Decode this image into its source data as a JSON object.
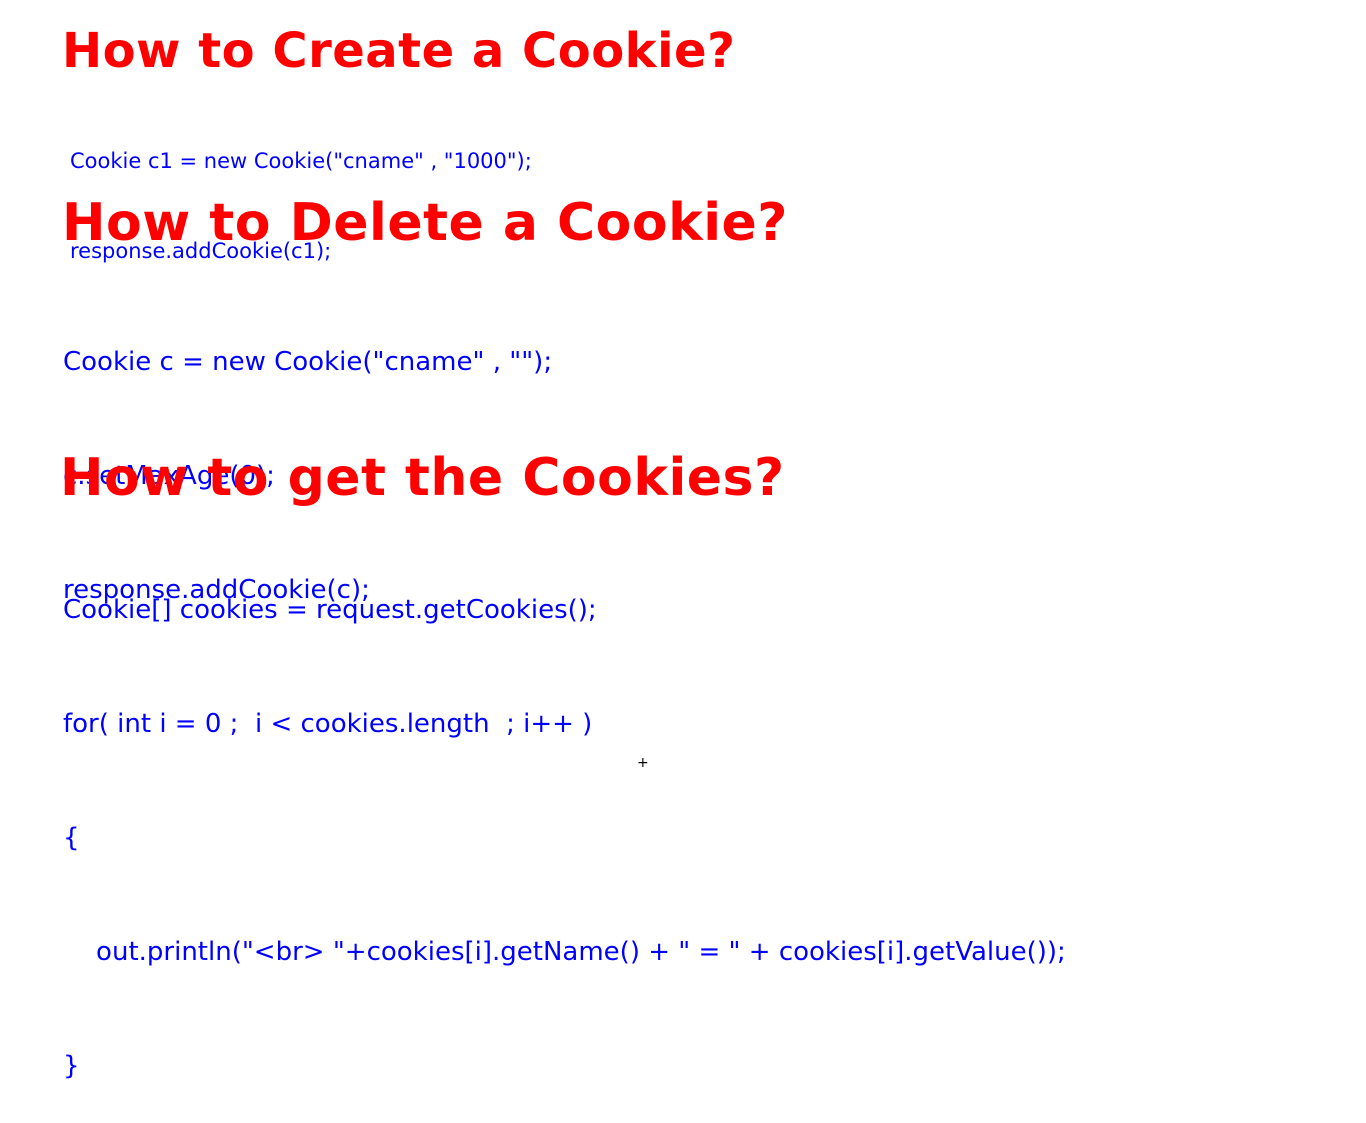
{
  "sections": [
    {
      "heading": "How to Create a Cookie?",
      "code": [
        "Cookie c1 = new Cookie(\"cname\" , \"1000\");",
        "response.addCookie(c1);"
      ]
    },
    {
      "heading": "How to Delete a Cookie?",
      "code": [
        "Cookie c = new Cookie(\"cname\" , \"\");",
        "c.setMaxAge(0);",
        "response.addCookie(c);"
      ]
    },
    {
      "heading": "How to get the Cookies?",
      "code": [
        "Cookie[] cookies = request.getCookies();",
        "for( int i = 0 ;  i < cookies.length  ; i++ )",
        "{",
        "    out.println(\"<br> \"+cookies[i].getName() + \" = \" + cookies[i].getValue());",
        "}"
      ]
    }
  ],
  "footer_mark": "+",
  "colors": {
    "heading": "#ff0000",
    "code": "#0000ff",
    "background": "#ffffff"
  }
}
